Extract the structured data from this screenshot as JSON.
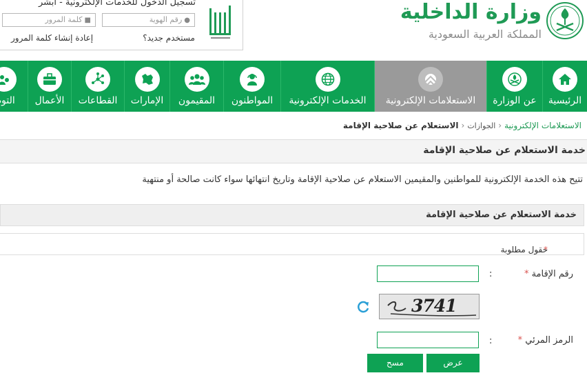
{
  "header": {
    "ministry_title": "وزارة الداخلية",
    "ministry_subtitle": "المملكة العربية السعودية",
    "login": {
      "title": "تسجيل الدخول للخدمات الإلكترونية - أبشر",
      "id_placeholder": "رقم الهوية",
      "password_placeholder": "كلمة المرور",
      "new_user_link": "مستخدم جديد؟",
      "reset_password_link": "إعادة إنشاء كلمة المرور"
    }
  },
  "nav": {
    "items": [
      {
        "label": "الرئيسية",
        "icon": "home-icon"
      },
      {
        "label": "عن الوزارة",
        "icon": "emblem-icon"
      },
      {
        "label": "الاستعلامات الإلكترونية",
        "icon": "inquiry-icon",
        "active": true
      },
      {
        "label": "الخدمات الإلكترونية",
        "icon": "globe-icon"
      },
      {
        "label": "المواطنون",
        "icon": "citizen-icon"
      },
      {
        "label": "المقيمون",
        "icon": "residents-icon"
      },
      {
        "label": "الإمارات",
        "icon": "map-icon"
      },
      {
        "label": "القطاعات",
        "icon": "network-icon"
      },
      {
        "label": "الأعمال",
        "icon": "briefcase-icon"
      },
      {
        "label": "التوظ",
        "icon": "jobs-icon"
      }
    ]
  },
  "breadcrumb": {
    "items": [
      "الاستعلامات الإلكترونية",
      "الجوازات"
    ],
    "current": "الاستعلام عن صلاحية الإقامة"
  },
  "page": {
    "heading": "خدمة الاستعلام عن صلاحية الإقامة",
    "description": "تتيح هذه الخدمة الإلكترونية للمواطنين والمقيمين الاستعلام عن صلاحية الإقامة وتاريخ انتهائها سواء كانت صالحة أو منتهية"
  },
  "form": {
    "title": "خدمة الاستعلام عن صلاحية الإقامة",
    "required_note": "حقول مطلوبة",
    "required_star": "*",
    "colon": ":",
    "iqama_label": "رقم الإقامة",
    "iqama_value": "",
    "captcha_text": "3741",
    "visual_code_label": "الرمز المرئي",
    "visual_code_value": "",
    "submit_label": "عرض",
    "clear_label": "مسح"
  },
  "colors": {
    "brand_green": "#0ea254",
    "active_gray": "#9a9a9a",
    "required_red": "#d9534f"
  }
}
